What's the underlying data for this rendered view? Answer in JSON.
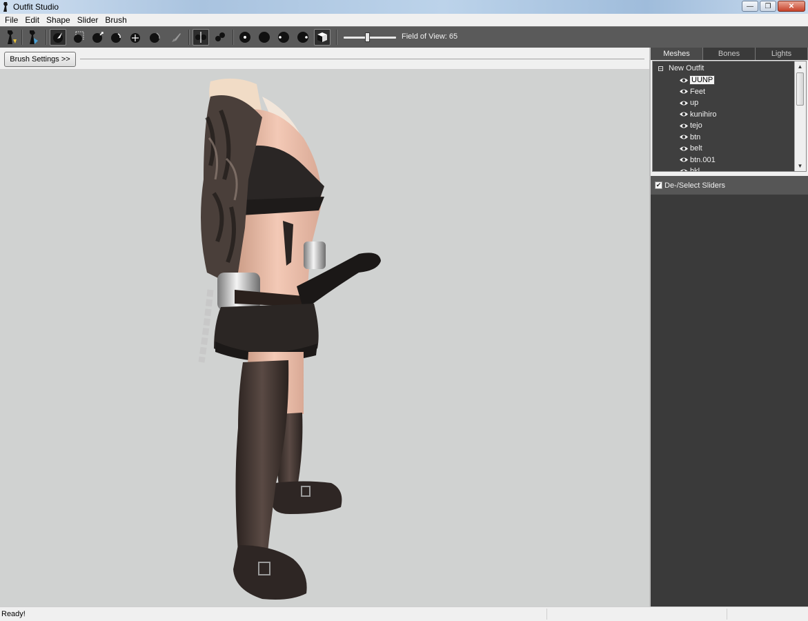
{
  "window": {
    "title": "Outfit Studio"
  },
  "menu": {
    "items": [
      "File",
      "Edit",
      "Shape",
      "Slider",
      "Brush"
    ]
  },
  "toolbar": {
    "fov_label": "Field of View: 65",
    "fov_value": 65
  },
  "brush": {
    "settings_label": "Brush Settings >>"
  },
  "panel": {
    "tabs": [
      "Meshes",
      "Bones",
      "Lights"
    ],
    "active_tab": "Meshes",
    "root_label": "New Outfit",
    "meshes": [
      "UUNP",
      "Feet",
      "up",
      "kunihiro",
      "tejo",
      "btn",
      "belt",
      "btn.001",
      "bkl"
    ],
    "selected_mesh": "UUNP",
    "sliders_label": "De-/Select Sliders"
  },
  "status": {
    "text": "Ready!"
  },
  "colors": {
    "toolbar_bg": "#5a5a5a",
    "viewport_bg": "#d0d2d1",
    "panel_bg": "#3a3a3a"
  }
}
